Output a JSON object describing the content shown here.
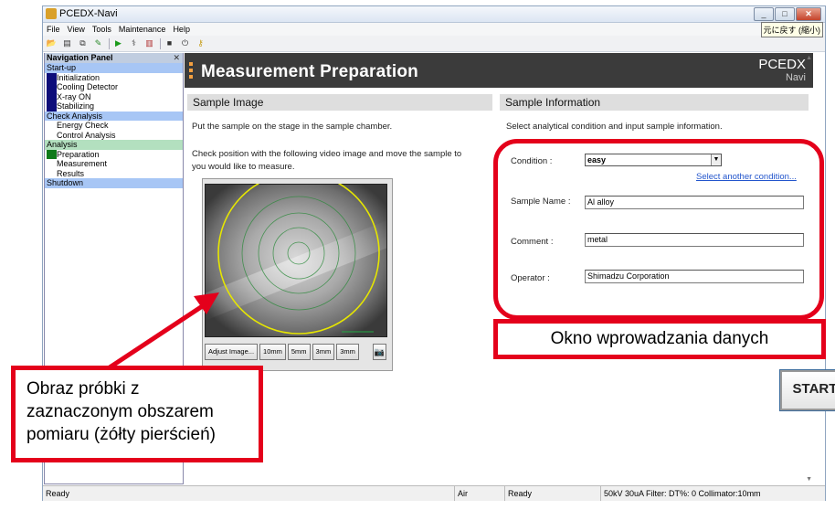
{
  "window": {
    "title": "PCEDX-Navi",
    "minimize": "_",
    "maximize": "□",
    "close": "✕",
    "restore_tip": "元に戻す (縮小)"
  },
  "menu": [
    "File",
    "View",
    "Tools",
    "Maintenance",
    "Help"
  ],
  "toolbar": {
    "icons": [
      "open-folder-icon",
      "document-icon",
      "copy-icon",
      "edit-icon",
      "run-icon",
      "analyze-icon",
      "report-icon",
      "save-icon",
      "power-icon",
      "key-icon"
    ],
    "glyphs": [
      "📂",
      "▤",
      "⧉",
      "✎",
      "▶",
      "⚕",
      "▥",
      "■",
      "⏻",
      "⚷"
    ]
  },
  "nav": {
    "title": "Navigation Panel",
    "close": "✕",
    "groups": [
      {
        "label": "Start-up",
        "color": "blue",
        "items": [
          {
            "label": "Initialization",
            "marker": "navy"
          },
          {
            "label": "Cooling Detector",
            "marker": "navy"
          },
          {
            "label": "X-ray ON",
            "marker": "navy"
          },
          {
            "label": "Stabilizing",
            "marker": "navy"
          }
        ]
      },
      {
        "label": "Check Analysis",
        "color": "blue",
        "items": [
          {
            "label": "Energy Check",
            "marker": ""
          },
          {
            "label": "Control Analysis",
            "marker": ""
          }
        ]
      },
      {
        "label": "Analysis",
        "color": "green",
        "items": [
          {
            "label": "Preparation",
            "marker": "green"
          },
          {
            "label": "Measurement",
            "marker": ""
          },
          {
            "label": "Results",
            "marker": ""
          }
        ]
      },
      {
        "label": "Shutdown",
        "color": "blue",
        "items": []
      }
    ]
  },
  "banner": {
    "title": "Measurement Preparation",
    "brand_main": "PCEDX",
    "brand_sub": "Navi"
  },
  "sample_image": {
    "heading": "Sample Image",
    "instruction1": "Put the sample on the stage in the sample chamber.",
    "instruction2a": "Check position with the following video image and move the sample to",
    "instruction2b": "you would like to measure.",
    "adjust_button": "Adjust Image...",
    "size_buttons": [
      "10mm",
      "5mm",
      "3mm",
      "3mm"
    ],
    "camera_button": "📷"
  },
  "sample_info": {
    "heading": "Sample Information",
    "instruction": "Select analytical condition and input sample information.",
    "condition_label": "Condition :",
    "condition_value": "easy",
    "select_link": "Select another condition...",
    "name_label": "Sample Name :",
    "name_value": "Al alloy",
    "comment_label": "Comment :",
    "comment_value": "metal",
    "operator_label": "Operator :",
    "operator_value": "Shimadzu Corporation"
  },
  "start_button": "START",
  "status": {
    "left": "Ready",
    "atmosphere": "Air",
    "state": "Ready",
    "xray": "50kV  30uA  Filter: DT%: 0 Collimator:10mm"
  },
  "annotations": {
    "data_entry": "Okno wprowadzania danych",
    "image_note": "Obraz próbki z zaznaczonym obszarem pomiaru (żółty pierścień)",
    "color": "#e4001b"
  }
}
